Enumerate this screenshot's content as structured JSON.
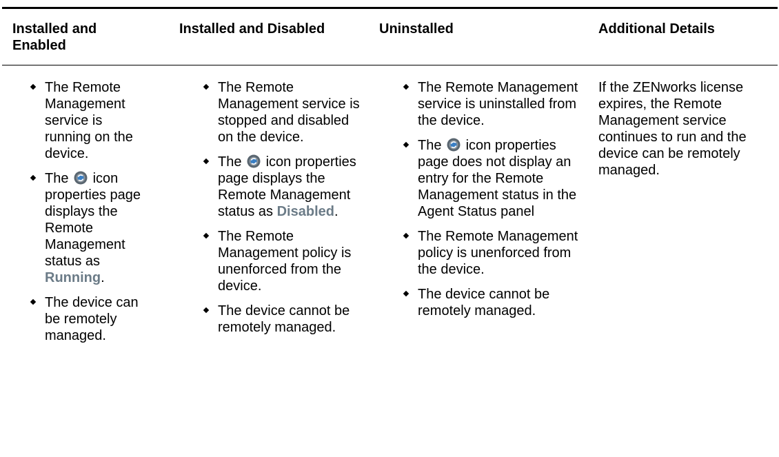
{
  "colors": {
    "status_text": "#6b7b87",
    "rule": "#000000",
    "icon_outer": "#5a6670",
    "icon_inner": "#3a7fc4"
  },
  "headers": {
    "col1": "Installed and Enabled",
    "col2": "Installed and Disabled",
    "col3": "Uninstalled",
    "col4": "Additional Details"
  },
  "col1": {
    "b1": "The Remote Management service is running on the device.",
    "b2_pre": "The",
    "b2_icon": "zenworks-icon",
    "b2_mid": "icon properties page displays the Remote Management status as",
    "b2_status": "Running",
    "b2_post": ".",
    "b3": "The device can be remotely managed."
  },
  "col2": {
    "b1": "The Remote Management service is stopped and disabled on the device.",
    "b2_pre": "The",
    "b2_icon": "zenworks-icon",
    "b2_mid": "icon properties page displays the Remote Management status as",
    "b2_status": "Disabled",
    "b2_post": ".",
    "b3": "The Remote Management policy is unenforced from the device.",
    "b4": "The device cannot be remotely managed."
  },
  "col3": {
    "b1": "The Remote Management service is uninstalled from the device.",
    "b2_pre": "The",
    "b2_icon": "zenworks-icon",
    "b2_mid": "icon properties page does not display an entry for the Remote Management status in the Agent Status panel",
    "b3": "The Remote Management policy is unenforced from the device.",
    "b4": "The device cannot be remotely managed."
  },
  "col4": {
    "text": "If the ZENworks license expires, the Remote Management service continues to run and the device can be remotely managed."
  }
}
